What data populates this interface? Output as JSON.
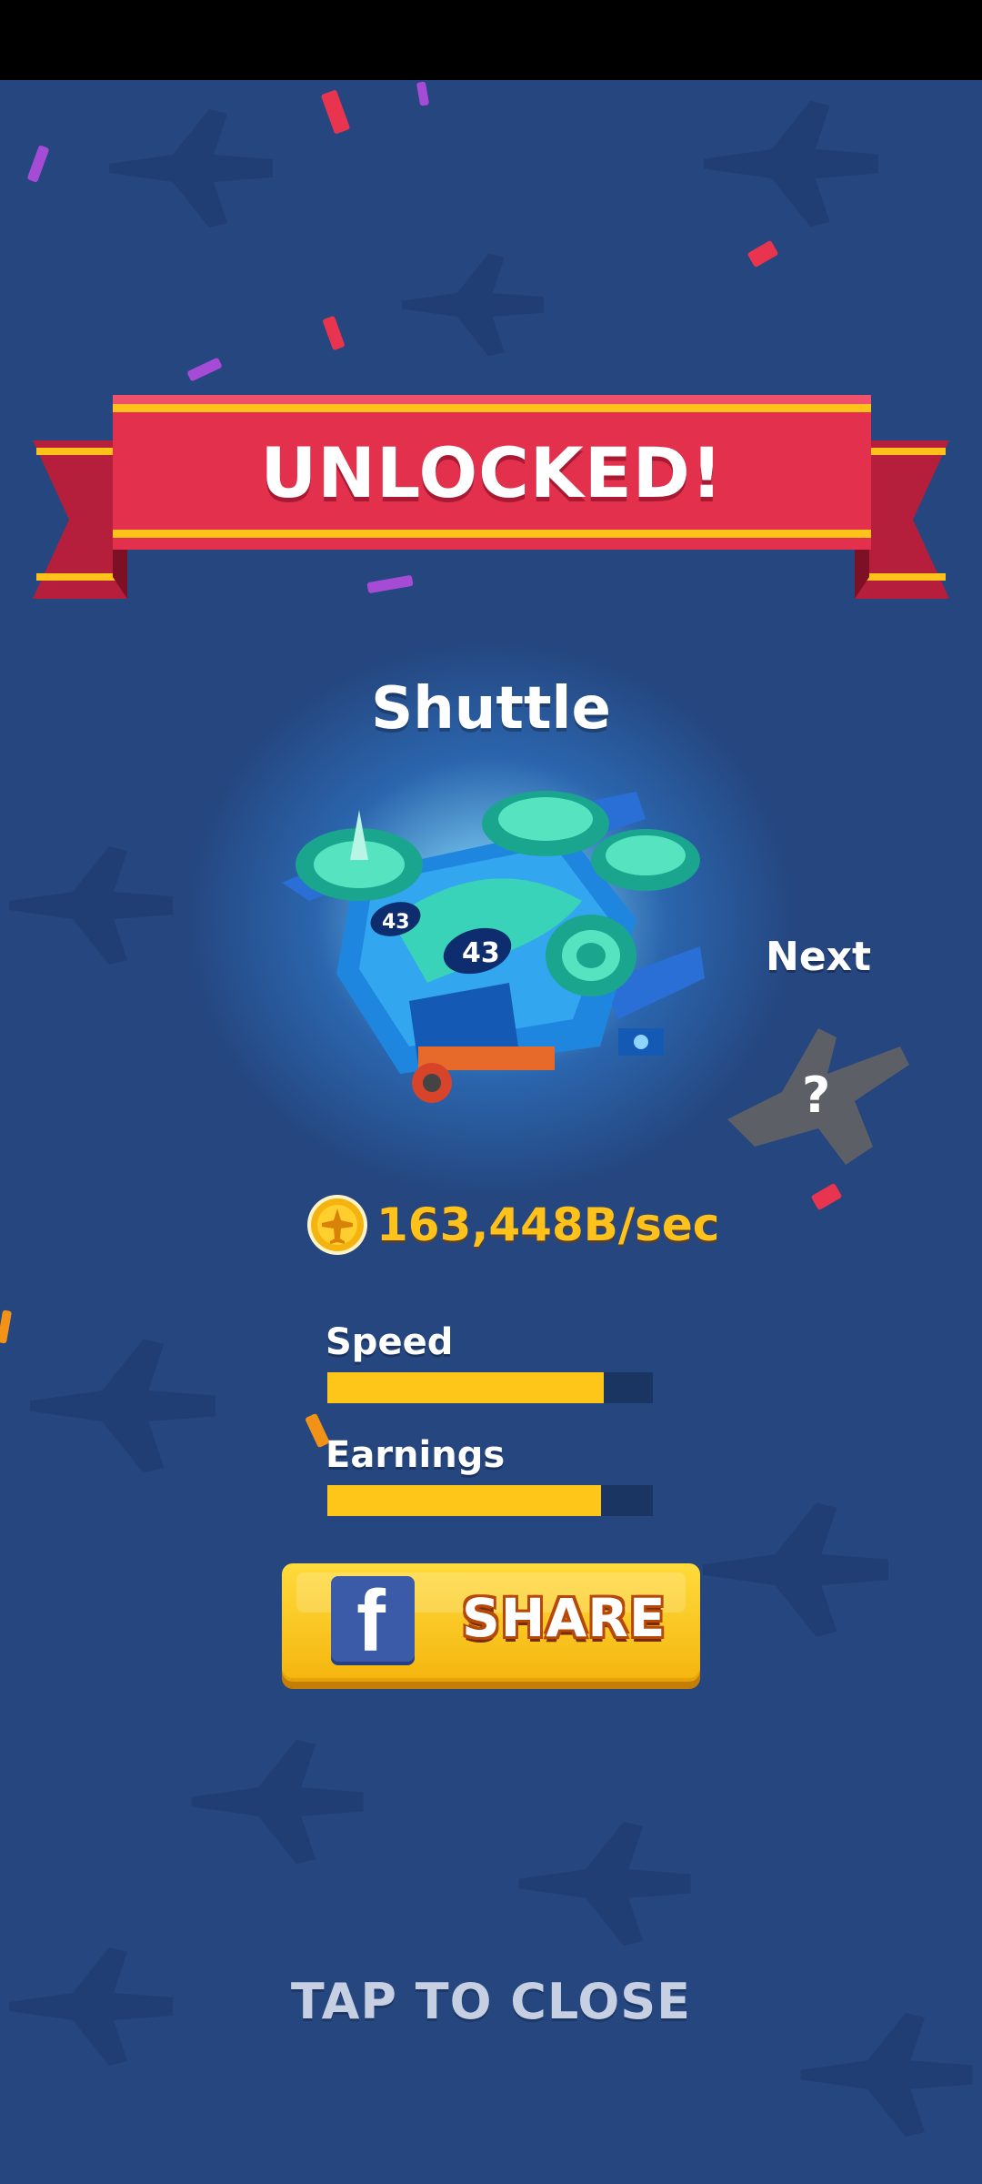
{
  "banner": {
    "title": "UNLOCKED!"
  },
  "plane": {
    "name": "Shuttle",
    "badge_number": "43"
  },
  "next": {
    "label": "Next",
    "mystery_mark": "?"
  },
  "earnings": {
    "rate": "163,448B/sec",
    "coin_icon": "plane-coin-icon"
  },
  "stats": [
    {
      "label": "Speed",
      "fill_fraction": 0.85
    },
    {
      "label": "Earnings",
      "fill_fraction": 0.84
    }
  ],
  "share_button": {
    "label": "SHARE",
    "icon": "facebook-icon",
    "icon_letter": "f"
  },
  "close_hint": "TAP TO CLOSE",
  "colors": {
    "background": "#25467f",
    "ribbon": "#e2304d",
    "ribbon_stripe": "#ffc21b",
    "gold_text": "#ffc21b",
    "bar_fill": "#ffc61a",
    "bar_track": "#1b3562",
    "share_button": "#ffcf26",
    "facebook_blue": "#3b5aa7"
  }
}
